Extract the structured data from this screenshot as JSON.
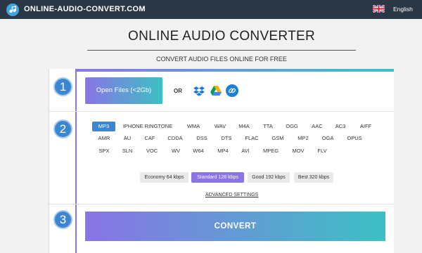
{
  "header": {
    "brand": "ONLINE-AUDIO-CONVERT.COM",
    "language": "English",
    "logo_icon": "music-note-icon",
    "flag_icon": "uk-flag-icon"
  },
  "main": {
    "title": "ONLINE AUDIO CONVERTER",
    "subtitle": "CONVERT AUDIO FILES ONLINE FOR FREE"
  },
  "steps": [
    "1",
    "2",
    "3"
  ],
  "upload": {
    "open_label": "Open Files (<2Gb)",
    "or_label": "OR",
    "sources": [
      "dropbox-icon",
      "google-drive-icon",
      "url-link-icon"
    ]
  },
  "formats": {
    "selected": "MP3",
    "rows": [
      [
        "MP3",
        "IPHONE RINGTONE",
        "WMA",
        "WAV",
        "M4A",
        "TTA",
        "OGG",
        "AAC",
        "AC3",
        "AIFF"
      ],
      [
        "AMR",
        "AU",
        "CAF",
        "CDDA",
        "DSS",
        "DTS",
        "FLAC",
        "GSM",
        "MP2",
        "OGA",
        "OPUS"
      ],
      [
        "SPX",
        "SLN",
        "VOC",
        "WV",
        "W64",
        "MP4",
        "AVI",
        "MPEG",
        "MOV",
        "FLV"
      ]
    ]
  },
  "quality": {
    "options": [
      "Economy 64 kbps",
      "Standard 128 kbps",
      "Good 192 kbps",
      "Best 320 kbps"
    ],
    "selected": "Standard 128 kbps"
  },
  "advanced_label": "ADVANCED SETTINGS",
  "convert_label": "CONVERT",
  "colors": {
    "topbar": "#2a3846",
    "accent_start": "#8a74e6",
    "accent_end": "#3cc0c4",
    "step_blue": "#3a86d1"
  }
}
